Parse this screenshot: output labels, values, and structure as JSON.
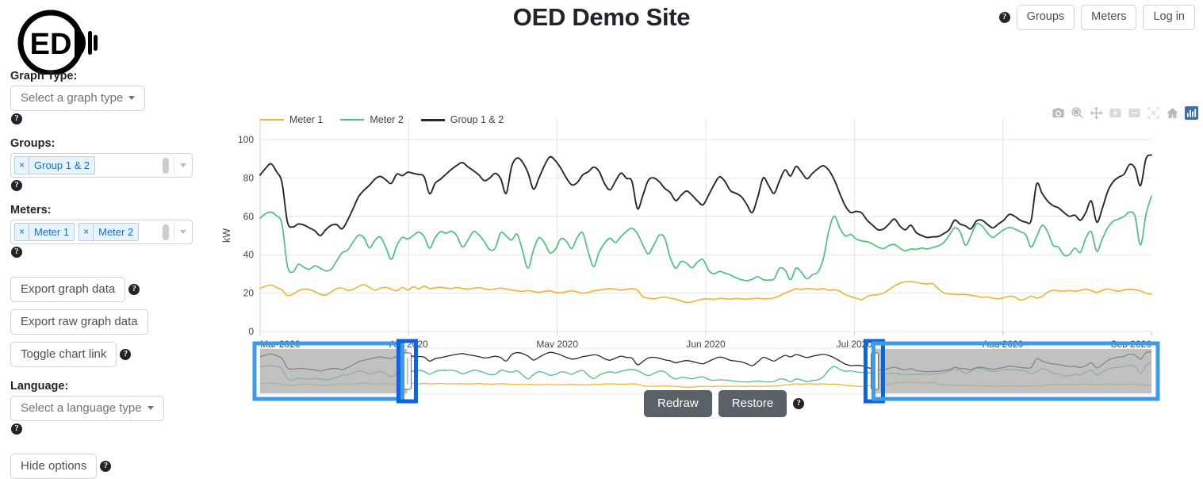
{
  "header": {
    "title": "OED Demo Site",
    "logo_text": "ED",
    "help_icon": "question-mark-icon",
    "buttons": [
      {
        "label": "Groups"
      },
      {
        "label": "Meters"
      },
      {
        "label": "Log in"
      }
    ]
  },
  "sidebar": {
    "graph_type": {
      "label": "Graph Type:",
      "value": "Select a graph type"
    },
    "groups": {
      "label": "Groups:",
      "tokens": [
        "Group 1 & 2"
      ],
      "remove_glyph": "×"
    },
    "meters": {
      "label": "Meters:",
      "tokens": [
        "Meter 1",
        "Meter 2"
      ],
      "remove_glyph": "×"
    },
    "export_graph": "Export graph data",
    "export_raw": "Export raw graph data",
    "toggle_chart_link": "Toggle chart link",
    "language": {
      "label": "Language:",
      "value": "Select a language type"
    },
    "hide_options": "Hide options"
  },
  "chart_controls": {
    "redraw": "Redraw",
    "restore": "Restore"
  },
  "modebar": {
    "icons": [
      "camera-icon",
      "zoom-icon",
      "pan-icon",
      "zoom-in-icon",
      "zoom-out-icon",
      "autoscale-icon",
      "reset-axes-icon",
      "plotly-logo-icon"
    ],
    "active_index": 7,
    "active_color": "#3f6fa8"
  },
  "colors": {
    "meter1": "#edb73b",
    "meter2": "#4cc07d",
    "group": "#23292f",
    "annotation_light": "#3d9be9",
    "annotation_dark": "#0b64e0",
    "rangeslider_mask": "#a9a9a9",
    "secondary_button": "#5a6268"
  },
  "chart_data": {
    "type": "line",
    "title": "",
    "xlabel": "",
    "ylabel": "kW",
    "ylim": [
      0,
      100
    ],
    "yticks": [
      0,
      20,
      40,
      60,
      80,
      100
    ],
    "xticks": [
      "Mar 2020",
      "Apr 2020",
      "May 2020",
      "Jun 2020",
      "Jul 2020",
      "Aug 2020",
      "Sep 2020"
    ],
    "grid": true,
    "legend_position": "top-left",
    "x_range": [
      "Mar 2020",
      "Sep 2020"
    ],
    "series": [
      {
        "name": "Meter 1",
        "color": "#edb73b",
        "values": [
          22.5,
          23.6,
          24.2,
          23.0,
          21.6,
          18.8,
          19.4,
          21.2,
          22.0,
          21.8,
          20.8,
          19.4,
          19.0,
          20.6,
          22.3,
          22.6,
          21.4,
          22.0,
          23.4,
          24.4,
          23.0,
          21.5,
          22.6,
          23.0,
          22.0,
          21.3,
          22.9,
          21.6,
          23.3,
          22.2,
          23.6,
          22.4,
          22.7,
          23.1,
          22.6,
          22.4,
          22.9,
          22.4,
          22.1,
          22.5,
          22.8,
          22.3,
          21.8,
          22.2,
          22.6,
          22.2,
          21.6,
          21.2,
          20.9,
          21.3,
          20.8,
          20.4,
          20.9,
          21.1,
          20.4,
          20.2,
          20.7,
          21.2,
          20.6,
          20.0,
          20.4,
          21.1,
          21.6,
          22.0,
          22.3,
          22.0,
          21.6,
          21.9,
          22.3,
          21.5,
          18.1,
          17.4,
          17.0,
          17.6,
          17.9,
          17.4,
          16.8,
          15.9,
          15.1,
          15.4,
          16.3,
          16.9,
          17.0,
          16.7,
          17.2,
          17.1,
          16.8,
          17.2,
          17.0,
          16.8,
          17.1,
          17.3,
          17.0,
          17.1,
          17.5,
          18.6,
          20.0,
          21.2,
          22.2,
          21.9,
          22.4,
          22.2,
          21.9,
          22.3,
          21.5,
          21.8,
          21.0,
          19.2,
          18.2,
          17.3,
          16.6,
          18.2,
          19.0,
          19.2,
          20.1,
          21.8,
          23.7,
          25.2,
          25.9,
          26.0,
          25.6,
          25.0,
          24.8,
          24.9,
          22.3,
          20.2,
          19.6,
          19.4,
          19.2,
          19.3,
          18.9,
          18.4,
          17.8,
          18.0,
          17.4,
          17.0,
          17.6,
          18.3,
          18.0,
          16.4,
          17.0,
          18.4,
          17.4,
          18.3,
          20.4,
          21.5,
          21.2,
          21.0,
          21.3,
          21.0,
          21.4,
          22.0,
          21.3,
          20.4,
          21.4,
          22.1,
          21.5,
          21.0,
          21.6,
          22.0,
          21.7,
          21.2,
          19.9,
          19.4
        ]
      },
      {
        "name": "Meter 2",
        "color": "#4cc07d",
        "values": [
          59.0,
          61.4,
          62.2,
          60.3,
          56.0,
          34.0,
          31.0,
          35.0,
          33.5,
          32.4,
          34.2,
          33.0,
          31.6,
          32.4,
          36.8,
          41.0,
          42.4,
          46.6,
          50.2,
          48.8,
          43.5,
          47.5,
          49.2,
          43.8,
          37.6,
          44.8,
          49.0,
          48.2,
          50.0,
          51.8,
          49.4,
          43.4,
          48.8,
          52.0,
          51.2,
          52.2,
          49.8,
          44.0,
          47.6,
          52.0,
          50.4,
          46.8,
          42.6,
          43.4,
          51.4,
          49.8,
          47.6,
          50.8,
          42.0,
          33.0,
          42.6,
          48.8,
          46.2,
          41.0,
          42.9,
          48.3,
          47.0,
          43.2,
          48.9,
          51.4,
          41.5,
          33.8,
          41.4,
          46.0,
          48.6,
          46.4,
          49.5,
          52.2,
          53.8,
          51.0,
          45.0,
          40.5,
          45.0,
          50.2,
          48.6,
          38.4,
          33.0,
          36.5,
          35.6,
          33.2,
          36.2,
          37.4,
          32.0,
          30.0,
          31.3,
          30.4,
          29.5,
          28.0,
          27.0,
          26.5,
          27.2,
          28.6,
          27.0,
          26.8,
          27.4,
          33.0,
          32.0,
          27.0,
          33.0,
          30.8,
          27.4,
          29.6,
          31.0,
          38.0,
          52.4,
          60.2,
          54.0,
          49.8,
          50.6,
          48.2,
          47.2,
          46.8,
          45.6,
          44.0,
          43.2,
          44.8,
          45.3,
          43.4,
          42.0,
          43.0,
          42.8,
          43.5,
          43.0,
          43.8,
          44.6,
          46.3,
          50.0,
          54.0,
          52.0,
          45.0,
          50.0,
          56.0,
          55.0,
          51.4,
          49.0,
          51.0,
          53.0,
          54.2,
          53.4,
          52.0,
          50.4,
          44.0,
          49.4,
          55.3,
          52.0,
          45.0,
          44.0,
          39.8,
          40.0,
          43.5,
          41.2,
          48.6,
          52.0,
          41.8,
          48.2,
          54.0,
          57.4,
          58.6,
          60.0,
          62.2,
          60.0,
          45.0,
          61.0,
          70.5
        ]
      },
      {
        "name": "Group 1 & 2",
        "color": "#23292f",
        "values": [
          81.5,
          85.0,
          87.4,
          83.3,
          77.6,
          57.0,
          54.5,
          56.0,
          55.5,
          54.0,
          52.5,
          50.0,
          53.0,
          55.3,
          55.7,
          53.5,
          58.0,
          64.0,
          70.2,
          73.6,
          76.2,
          79.4,
          80.8,
          79.0,
          77.2,
          82.0,
          81.2,
          83.0,
          82.4,
          81.8,
          80.6,
          71.8,
          77.2,
          79.4,
          82.0,
          84.5,
          86.6,
          88.0,
          85.8,
          83.8,
          81.6,
          78.6,
          80.0,
          82.4,
          79.6,
          72.0,
          86.0,
          90.4,
          88.2,
          82.6,
          74.2,
          80.0,
          86.5,
          91.0,
          89.0,
          85.0,
          80.0,
          76.4,
          77.6,
          81.6,
          83.2,
          85.6,
          83.4,
          77.0,
          73.8,
          78.4,
          82.5,
          79.8,
          78.2,
          64.0,
          71.0,
          78.8,
          80.0,
          78.0,
          74.6,
          72.4,
          68.2,
          71.0,
          73.2,
          71.0,
          68.0,
          66.0,
          71.0,
          76.4,
          80.6,
          78.2,
          73.4,
          72.0,
          70.3,
          66.2,
          62.0,
          70.0,
          80.0,
          76.0,
          72.0,
          78.6,
          84.2,
          81.0,
          86.0,
          83.0,
          79.6,
          82.4,
          84.8,
          86.4,
          84.0,
          79.0,
          72.0,
          65.5,
          62.0,
          62.6,
          61.8,
          58.0,
          55.4,
          53.0,
          53.4,
          56.0,
          58.6,
          55.0,
          53.0,
          55.4,
          51.5,
          50.0,
          49.0,
          49.3,
          49.5,
          51.0,
          53.0,
          58.0,
          56.0,
          55.0,
          53.5,
          57.6,
          58.0,
          55.8,
          54.0,
          56.0,
          58.0,
          61.0,
          60.0,
          58.0,
          57.0,
          58.0,
          76.8,
          72.0,
          68.0,
          65.6,
          64.4,
          62.0,
          60.0,
          60.6,
          58.0,
          62.0,
          68.0,
          57.0,
          64.0,
          73.0,
          78.0,
          80.4,
          82.0,
          87.0,
          85.0,
          76.0,
          90.0,
          92.0
        ]
      }
    ]
  },
  "rangeslider": {
    "selection_left_pct": 0.165,
    "selection_right_pct": 0.689,
    "annotations": [
      {
        "name": "left-region-box",
        "color": "#3d9be9"
      },
      {
        "name": "left-handle-box",
        "color": "#0b64e0"
      },
      {
        "name": "right-handle-box",
        "color": "#0b64e0"
      },
      {
        "name": "right-region-box",
        "color": "#3d9be9"
      }
    ]
  }
}
